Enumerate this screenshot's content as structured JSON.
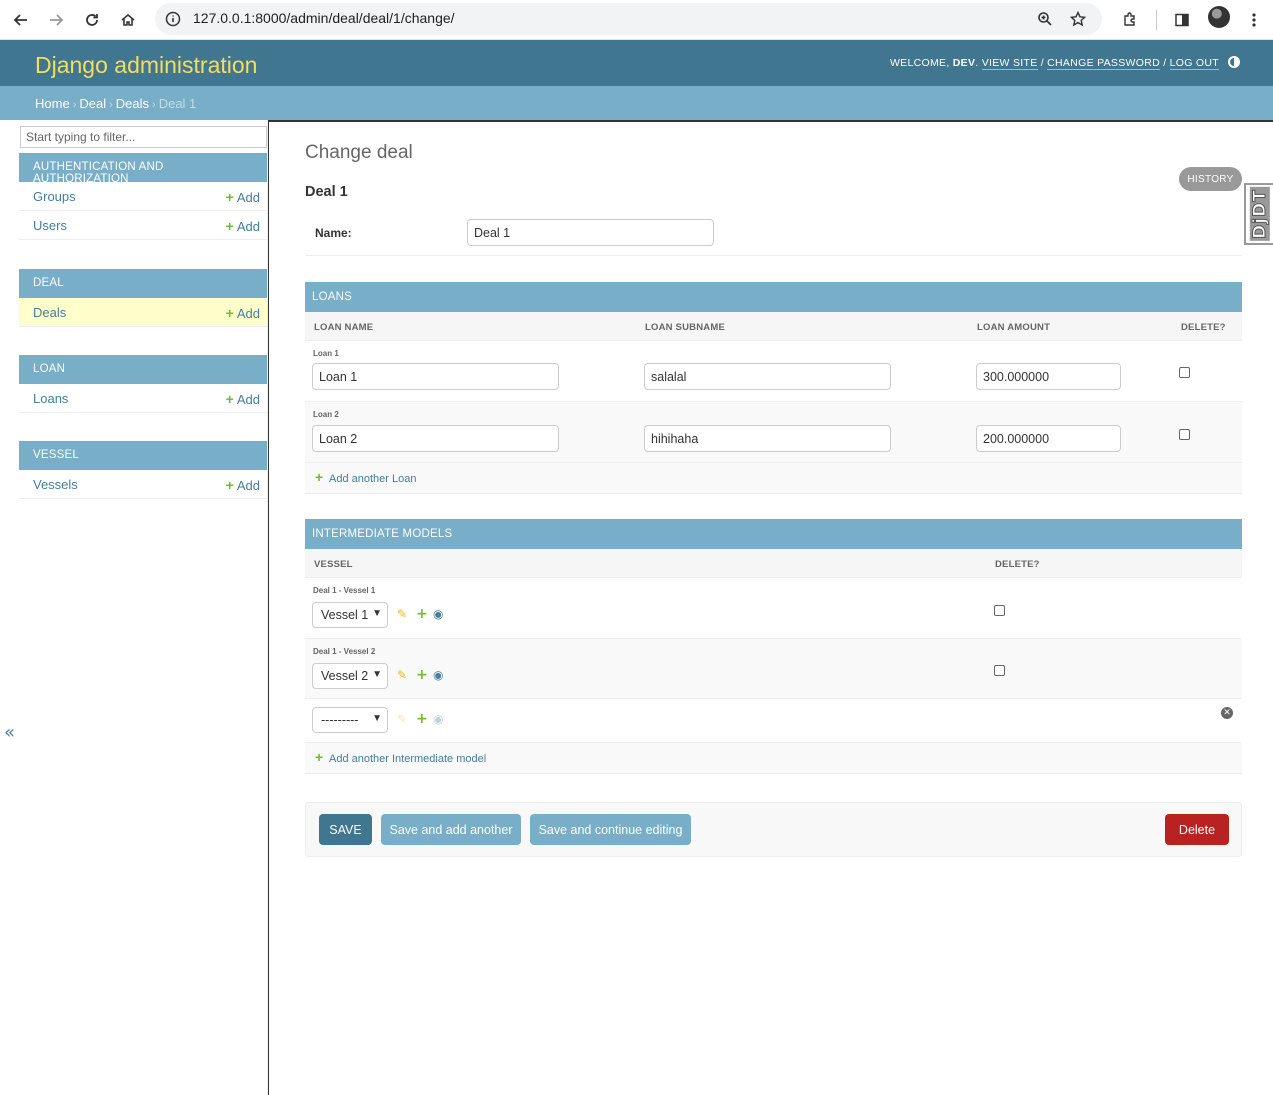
{
  "browser": {
    "url": "127.0.0.1:8000/admin/deal/deal/1/change/"
  },
  "header": {
    "branding": "Django administration",
    "welcome": "WELCOME,",
    "username": "DEV",
    "view_site": "VIEW SITE",
    "change_password": "CHANGE PASSWORD",
    "log_out": "LOG OUT",
    "sep": "/"
  },
  "breadcrumbs": {
    "home": "Home",
    "app": "Deal",
    "model": "Deals",
    "current": "Deal 1",
    "sep": "›"
  },
  "sidebar": {
    "filter_placeholder": "Start typing to filter...",
    "add_label": "Add",
    "apps": [
      {
        "caption": "AUTHENTICATION AND AUTHORIZATION",
        "models": [
          "Groups",
          "Users"
        ]
      },
      {
        "caption": "DEAL",
        "models": [
          "Deals"
        ]
      },
      {
        "caption": "LOAN",
        "models": [
          "Loans"
        ]
      },
      {
        "caption": "VESSEL",
        "models": [
          "Vessels"
        ]
      }
    ],
    "collapse_glyph": "«"
  },
  "content": {
    "title": "Change deal",
    "subtitle": "Deal 1",
    "history_label": "HISTORY",
    "djdt": "DjDT",
    "name_label": "Name:",
    "name_value": "Deal 1"
  },
  "loans": {
    "caption": "LOANS",
    "headers": {
      "name": "LOAN NAME",
      "subname": "LOAN SUBNAME",
      "amount": "LOAN AMOUNT",
      "delete": "DELETE?"
    },
    "rows": [
      {
        "label": "Loan 1",
        "name": "Loan 1",
        "subname": "salalal",
        "amount": "300.000000"
      },
      {
        "label": "Loan 2",
        "name": "Loan 2",
        "subname": "hihihaha",
        "amount": "200.000000"
      }
    ],
    "add_another": "Add another Loan"
  },
  "intermediate": {
    "caption": "INTERMEDIATE MODELS",
    "headers": {
      "vessel": "VESSEL",
      "delete": "DELETE?"
    },
    "rows": [
      {
        "label": "Deal 1 - Vessel 1",
        "vessel": "Vessel 1"
      },
      {
        "label": "Deal 1 - Vessel 2",
        "vessel": "Vessel 2"
      }
    ],
    "empty_select": "---------",
    "add_another": "Add another Intermediate model"
  },
  "submit": {
    "save": "SAVE",
    "save_add": "Save and add another",
    "save_continue": "Save and continue editing",
    "delete": "Delete"
  },
  "colors": {
    "header_bg": "#417690",
    "branding": "#f5dd5d",
    "caption_bg": "#79aec8",
    "link": "#447e9b",
    "save_bg": "#417690",
    "secondary_btn_bg": "#79aec8",
    "delete_bg": "#ba2121",
    "current_row_bg": "#ffffcc"
  }
}
